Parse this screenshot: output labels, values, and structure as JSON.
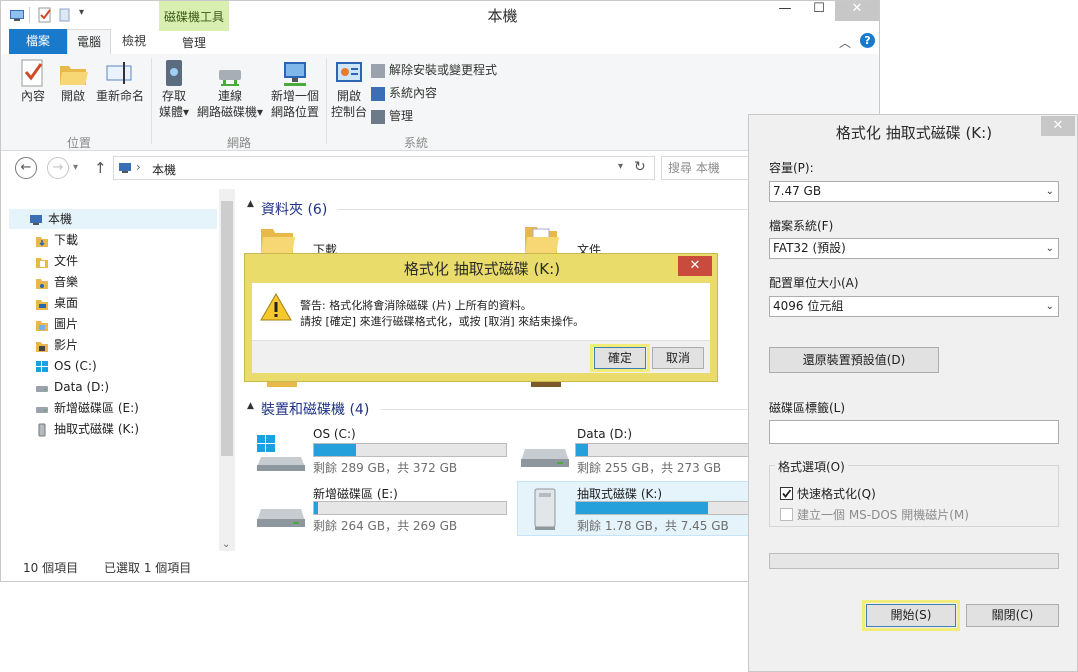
{
  "explorer": {
    "title": "本機",
    "context_tab": "磁碟機工具",
    "tabs": {
      "file": "檔案",
      "computer": "電腦",
      "view": "檢視",
      "manage": "管理"
    },
    "ribbon": {
      "properties": "內容",
      "open": "開啟",
      "rename": "重新命名",
      "access_media": "存取\n媒體",
      "access_media_l1": "存取",
      "access_media_l2": "媒體",
      "map_drive_l1": "連線",
      "map_drive_l2": "網路磁碟機",
      "add_location_l1": "新增一個",
      "add_location_l2": "網路位置",
      "control_panel_l1": "開啟",
      "control_panel_l2": "控制台",
      "uninstall": "解除安裝或變更程式",
      "system_properties": "系統內容",
      "manage": "管理",
      "group_location": "位置",
      "group_network": "網路",
      "group_system": "系統"
    },
    "address": {
      "path": "本機",
      "search_placeholder": "搜尋 本機"
    },
    "nav": {
      "root": "本機",
      "items": [
        "下載",
        "文件",
        "音樂",
        "桌面",
        "圖片",
        "影片",
        "OS (C:)",
        "Data (D:)",
        "新增磁碟區 (E:)",
        "抽取式磁碟 (K:)"
      ]
    },
    "folders": {
      "header": "資料夾 (6)",
      "visible": [
        "下載",
        "文件"
      ]
    },
    "devices": {
      "header": "裝置和磁碟機 (4)",
      "drives": [
        {
          "name": "OS (C:)",
          "free": "剩餘 289 GB，共 372 GB",
          "used_fraction": 0.22
        },
        {
          "name": "Data (D:)",
          "free": "剩餘 255 GB，共 273 GB",
          "used_fraction": 0.07
        },
        {
          "name": "新增磁碟區 (E:)",
          "free": "剩餘 264 GB，共 269 GB",
          "used_fraction": 0.02
        },
        {
          "name": "抽取式磁碟 (K:)",
          "free": "剩餘 1.78 GB，共 7.45 GB",
          "used_fraction": 0.76
        }
      ]
    },
    "status": {
      "count": "10 個項目",
      "selected": "已選取 1 個項目"
    }
  },
  "warning": {
    "title": "格式化 抽取式磁碟 (K:)",
    "line1": "警告: 格式化將會消除磁碟 (片) 上所有的資料。",
    "line2": "請按 [確定] 來進行磁碟格式化，或按 [取消] 來結束操作。",
    "ok": "確定",
    "cancel": "取消"
  },
  "format": {
    "title": "格式化 抽取式磁碟 (K:)",
    "capacity_label": "容量(P):",
    "capacity_value": "7.47 GB",
    "fs_label": "檔案系統(F)",
    "fs_value": "FAT32 (預設)",
    "alloc_label": "配置單位大小(A)",
    "alloc_value": "4096 位元組",
    "restore_button": "還原裝置預設值(D)",
    "volume_label": "磁碟區標籤(L)",
    "volume_value": "",
    "options_label": "格式選項(O)",
    "quick_format": "快速格式化(Q)",
    "quick_format_checked": true,
    "msdos": "建立一個 MS-DOS 開機磁片(M)",
    "msdos_checked": false,
    "progress": 0,
    "start": "開始(S)",
    "close": "關閉(C)"
  }
}
